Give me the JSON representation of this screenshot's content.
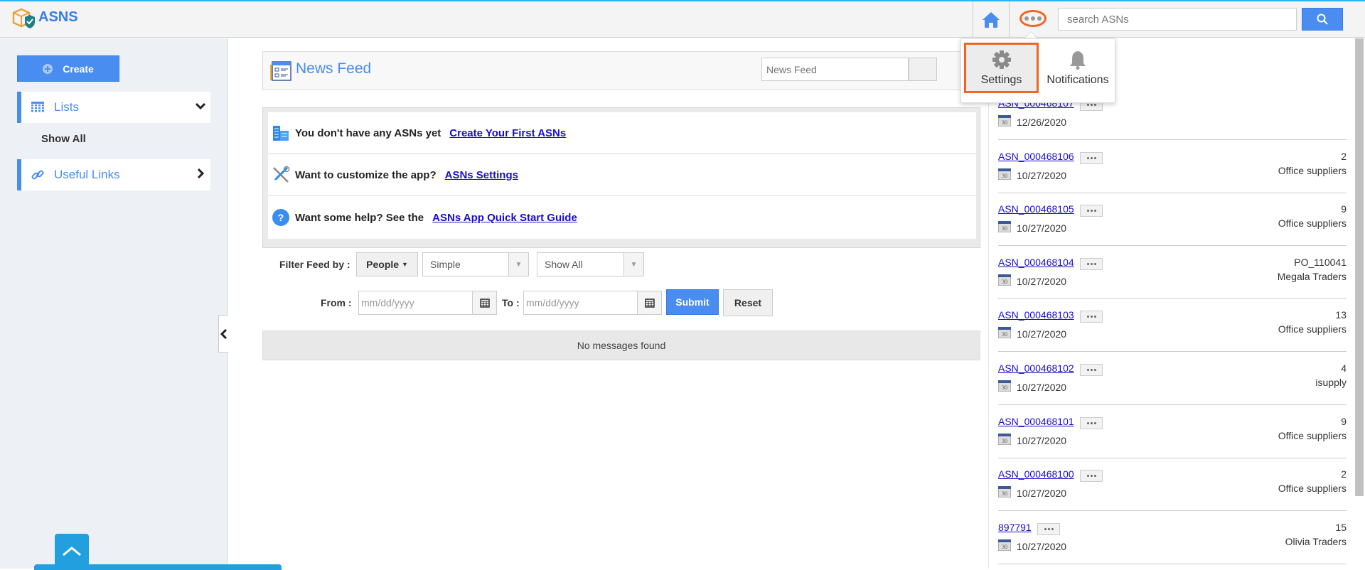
{
  "app": {
    "title": "ASNS",
    "accent": "#4a8df0",
    "highlight": "#f26522"
  },
  "topbar": {
    "search_placeholder": "search ASNs",
    "home_icon": "home-icon",
    "more_icon": "ellipsis-icon",
    "search_icon": "search-icon"
  },
  "dropdown": {
    "items": [
      {
        "label": "Settings",
        "icon": "gear-icon",
        "highlighted": true
      },
      {
        "label": "Notifications",
        "icon": "bell-icon"
      }
    ]
  },
  "sidebar": {
    "create_label": "Create",
    "lists_label": "Lists",
    "show_all": "Show All",
    "useful_links_label": "Useful Links"
  },
  "newsfeed": {
    "title": "News Feed",
    "search_placeholder": "News Feed",
    "info": [
      {
        "text": "You don't have any ASNs yet",
        "link": "Create Your First ASNs"
      },
      {
        "text": "Want to customize the app?",
        "link": "ASNs Settings"
      },
      {
        "text": "Want some help? See the",
        "link": "ASNs App Quick Start Guide"
      }
    ],
    "filter": {
      "label": "Filter Feed by :",
      "people": "People",
      "type": "Simple",
      "scope": "Show All",
      "from_label": "From :",
      "to_label": "To :",
      "date_placeholder": "mm/dd/yyyy",
      "submit": "Submit",
      "reset": "Reset"
    },
    "empty": "No messages found"
  },
  "asns": [
    {
      "id": "ASN_000468107",
      "date": "12/26/2020",
      "qty": "",
      "vendor": ""
    },
    {
      "id": "ASN_000468106",
      "date": "10/27/2020",
      "qty": "2",
      "vendor": "Office suppliers"
    },
    {
      "id": "ASN_000468105",
      "date": "10/27/2020",
      "qty": "9",
      "vendor": "Office suppliers"
    },
    {
      "id": "ASN_000468104",
      "date": "10/27/2020",
      "qty": "PO_110041",
      "vendor": "Megala Traders"
    },
    {
      "id": "ASN_000468103",
      "date": "10/27/2020",
      "qty": "13",
      "vendor": "Office suppliers"
    },
    {
      "id": "ASN_000468102",
      "date": "10/27/2020",
      "qty": "4",
      "vendor": "isupply"
    },
    {
      "id": "ASN_000468101",
      "date": "10/27/2020",
      "qty": "9",
      "vendor": "Office suppliers"
    },
    {
      "id": "ASN_000468100",
      "date": "10/27/2020",
      "qty": "2",
      "vendor": "Office suppliers"
    },
    {
      "id": "897791",
      "date": "10/27/2020",
      "qty": "15",
      "vendor": "Olivia Traders"
    }
  ]
}
